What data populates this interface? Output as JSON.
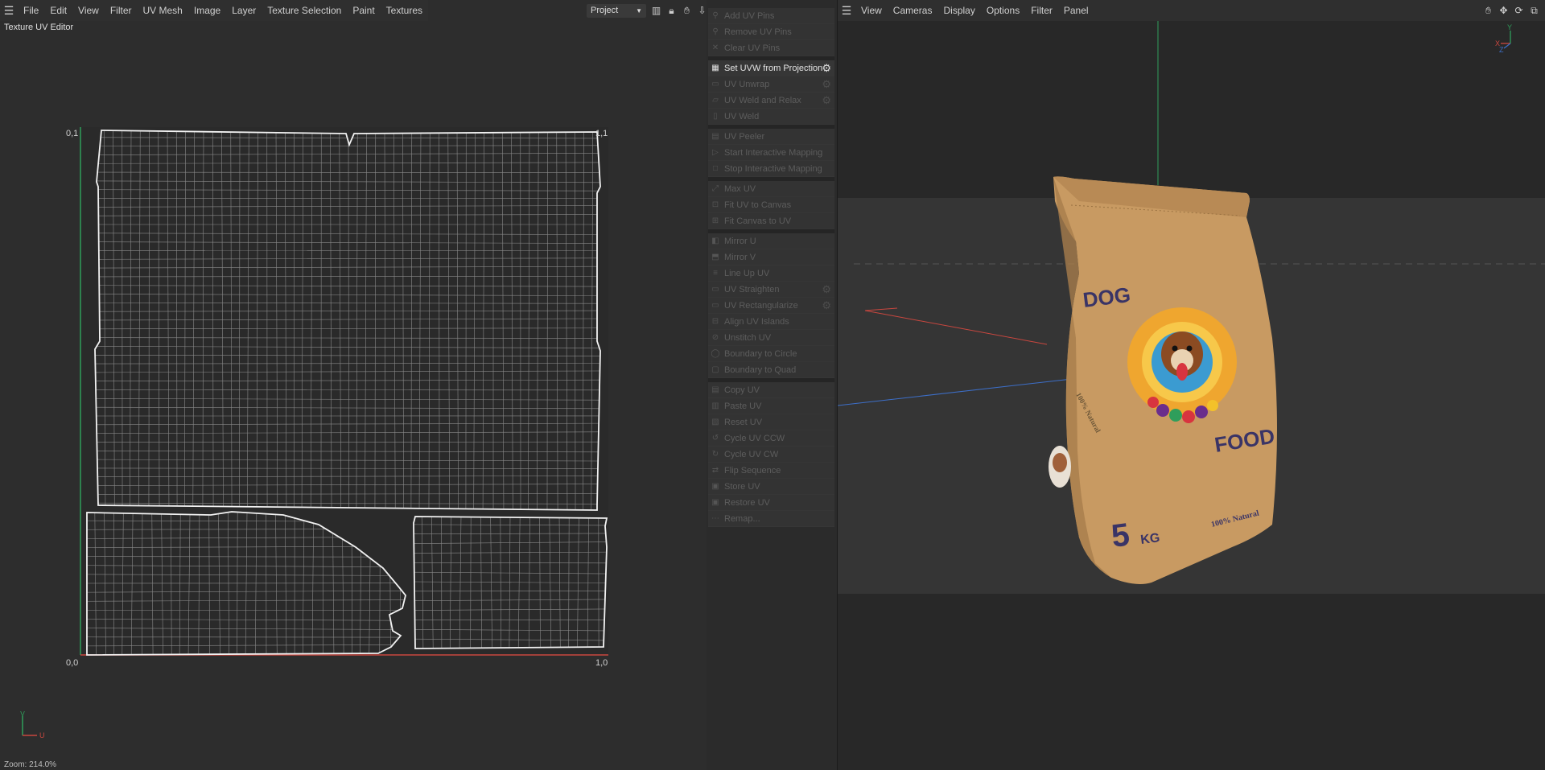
{
  "uv_editor": {
    "menu": [
      "File",
      "Edit",
      "View",
      "Filter",
      "UV Mesh",
      "Image",
      "Layer",
      "Texture Selection",
      "Paint",
      "Textures"
    ],
    "title": "Texture UV Editor",
    "project_select": "Project",
    "corner_labels": {
      "top_left": "0,1",
      "top_right": "1,1",
      "bottom_left": "0,0",
      "bottom_right": "1,0"
    },
    "axis_v": "V",
    "axis_u": "U",
    "zoom": "Zoom: 214.0%"
  },
  "uv_tools": {
    "groups": [
      [
        {
          "label": "Add UV Pins",
          "icon": "pin-icon",
          "enabled": false
        },
        {
          "label": "Remove UV Pins",
          "icon": "pin-remove-icon",
          "enabled": false
        },
        {
          "label": "Clear UV Pins",
          "icon": "clear-icon",
          "enabled": false
        }
      ],
      [
        {
          "label": "Set UVW from Projection",
          "icon": "checker-icon",
          "enabled": true,
          "gear": true
        },
        {
          "label": "UV Unwrap",
          "icon": "unwrap-icon",
          "enabled": false,
          "gear": true
        },
        {
          "label": "UV Weld and Relax",
          "icon": "weld-relax-icon",
          "enabled": false,
          "gear": true
        },
        {
          "label": "UV Weld",
          "icon": "weld-icon",
          "enabled": false
        }
      ],
      [
        {
          "label": "UV Peeler",
          "icon": "peeler-icon",
          "enabled": false
        },
        {
          "label": "Start Interactive Mapping",
          "icon": "play-icon",
          "enabled": false
        },
        {
          "label": "Stop Interactive Mapping",
          "icon": "stop-icon",
          "enabled": false
        }
      ],
      [
        {
          "label": "Max UV",
          "icon": "max-icon",
          "enabled": false
        },
        {
          "label": "Fit UV to Canvas",
          "icon": "fit-icon",
          "enabled": false
        },
        {
          "label": "Fit Canvas to UV",
          "icon": "fit-canvas-icon",
          "enabled": false
        }
      ],
      [
        {
          "label": "Mirror U",
          "icon": "mirror-u-icon",
          "enabled": false
        },
        {
          "label": "Mirror V",
          "icon": "mirror-v-icon",
          "enabled": false
        },
        {
          "label": "Line Up UV",
          "icon": "lineup-icon",
          "enabled": false
        },
        {
          "label": "UV Straighten",
          "icon": "straighten-icon",
          "enabled": false,
          "gear": true
        },
        {
          "label": "UV Rectangularize",
          "icon": "rectangularize-icon",
          "enabled": false,
          "gear": true
        },
        {
          "label": "Align UV Islands",
          "icon": "align-icon",
          "enabled": false
        },
        {
          "label": "Unstitch UV",
          "icon": "unstitch-icon",
          "enabled": false
        },
        {
          "label": "Boundary to Circle",
          "icon": "circle-icon",
          "enabled": false
        },
        {
          "label": "Boundary to Quad",
          "icon": "quad-icon",
          "enabled": false
        }
      ],
      [
        {
          "label": "Copy UV",
          "icon": "copy-icon",
          "enabled": false
        },
        {
          "label": "Paste UV",
          "icon": "paste-icon",
          "enabled": false
        },
        {
          "label": "Reset UV",
          "icon": "reset-icon",
          "enabled": false
        },
        {
          "label": "Cycle UV CCW",
          "icon": "cycle-ccw-icon",
          "enabled": false
        },
        {
          "label": "Cycle UV CW",
          "icon": "cycle-cw-icon",
          "enabled": false
        },
        {
          "label": "Flip Sequence",
          "icon": "flip-icon",
          "enabled": false
        },
        {
          "label": "Store UV",
          "icon": "store-icon",
          "enabled": false
        },
        {
          "label": "Restore UV",
          "icon": "restore-icon",
          "enabled": false
        },
        {
          "label": "Remap...",
          "icon": "remap-icon",
          "enabled": false
        }
      ]
    ]
  },
  "viewport": {
    "menu": [
      "View",
      "Cameras",
      "Display",
      "Options",
      "Filter",
      "Panel"
    ],
    "product": {
      "text_top": "DOG",
      "text_bottom": "FOOD",
      "weight_number": "5",
      "weight_unit": "KG",
      "badge": "100% Natural",
      "side_text": "100% Natural"
    },
    "gizmo": {
      "y": "Y",
      "x": "X",
      "z": "Z"
    }
  },
  "colors": {
    "accent_green": "#2f9e5b",
    "axis_red": "#c9473f",
    "axis_blue": "#3d6fc9",
    "bag_kraft": "#c89a62",
    "text_dark_purple": "#3a3466"
  }
}
